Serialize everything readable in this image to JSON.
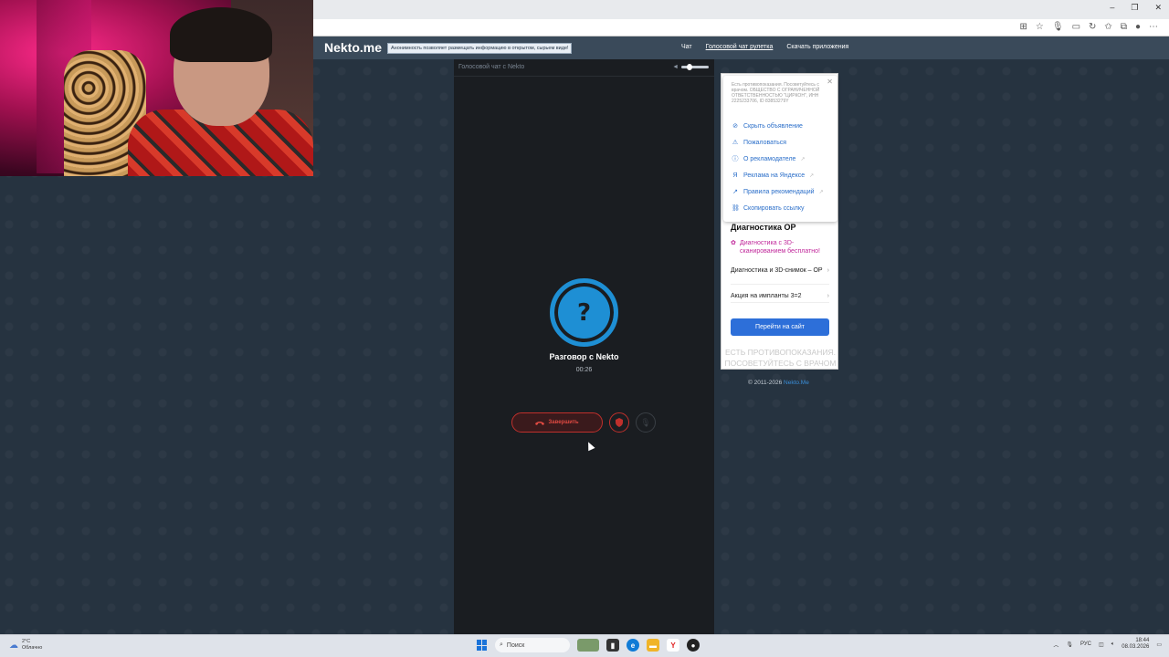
{
  "browser": {
    "window_controls": [
      "–",
      "❐",
      "✕"
    ],
    "toolbar_icons": [
      "apps-icon",
      "star-icon",
      "mic-icon",
      "extensions-icon",
      "puzzle-icon",
      "favorites-icon",
      "profile-icon",
      "menu-icon"
    ]
  },
  "header": {
    "logo": "Nekto.me",
    "notice": "Анонимность позволяет размещать информацию в открытом, сырьем виде!",
    "nav": [
      {
        "label": "Чат",
        "active": false
      },
      {
        "label": "Голосовой чат рулетка",
        "active": true
      },
      {
        "label": "Скачать приложения",
        "active": false
      }
    ]
  },
  "chat": {
    "title": "Голосовой чат с Nekto",
    "avatar_glyph": "?",
    "conversation_title": "Разговор с Nekto",
    "timer": "00:26",
    "end_button": "Завершить"
  },
  "ad": {
    "disclaimer": "Есть противопоказания. Посоветуйтесь с врачом. ОБЩЕСТВО С ОГРАНИЧЕННОЙ ОТВЕТСТВЕННОСТЬЮ \"ЦИРКОН\", ИНН 2225233706, ID 83853279Y",
    "menu": [
      {
        "label": "Скрыть объявление",
        "icon": "eye-off-icon",
        "glyph": "⊘",
        "external": false
      },
      {
        "label": "Пожаловаться",
        "icon": "warning-icon",
        "glyph": "⚠",
        "external": false
      },
      {
        "label": "О рекламодателе",
        "icon": "info-icon",
        "glyph": "ⓘ",
        "external": true
      },
      {
        "label": "Реклама на Яндексе",
        "icon": "yandex-icon",
        "glyph": "Я",
        "external": true
      },
      {
        "label": "Правила рекомендаций",
        "icon": "arrow-icon",
        "glyph": "↗",
        "external": true
      },
      {
        "label": "Скопировать ссылку",
        "icon": "link-icon",
        "glyph": "⛓",
        "external": false
      }
    ],
    "title": "Диагностика ОР",
    "promo": "Диагностика с 3D-сканированием бесплатно!",
    "rows": [
      "Диагностика и 3D-снимок – ОР",
      "Акция на импланты 3=2"
    ],
    "button": "Перейти на сайт",
    "warning": "ЕСТЬ ПРОТИВОПОКАЗАНИЯ. ПОСОВЕТУЙТЕСЬ С ВРАЧОМ"
  },
  "footer": {
    "copyright": "© 2011-2026",
    "link": "Nekto.Me"
  },
  "taskbar": {
    "temperature": "2°C",
    "condition": "Облачно",
    "search_placeholder": "Поиск",
    "language": "РУС",
    "time": "18:44",
    "date": "08.03.2026"
  },
  "colors": {
    "page_bg": "#263340",
    "header_bg": "#3a4a5a",
    "chat_bg": "#1a1d21",
    "accent_blue": "#1e8fd4",
    "end_red": "#c0302c",
    "ad_button": "#2d6fd9"
  }
}
